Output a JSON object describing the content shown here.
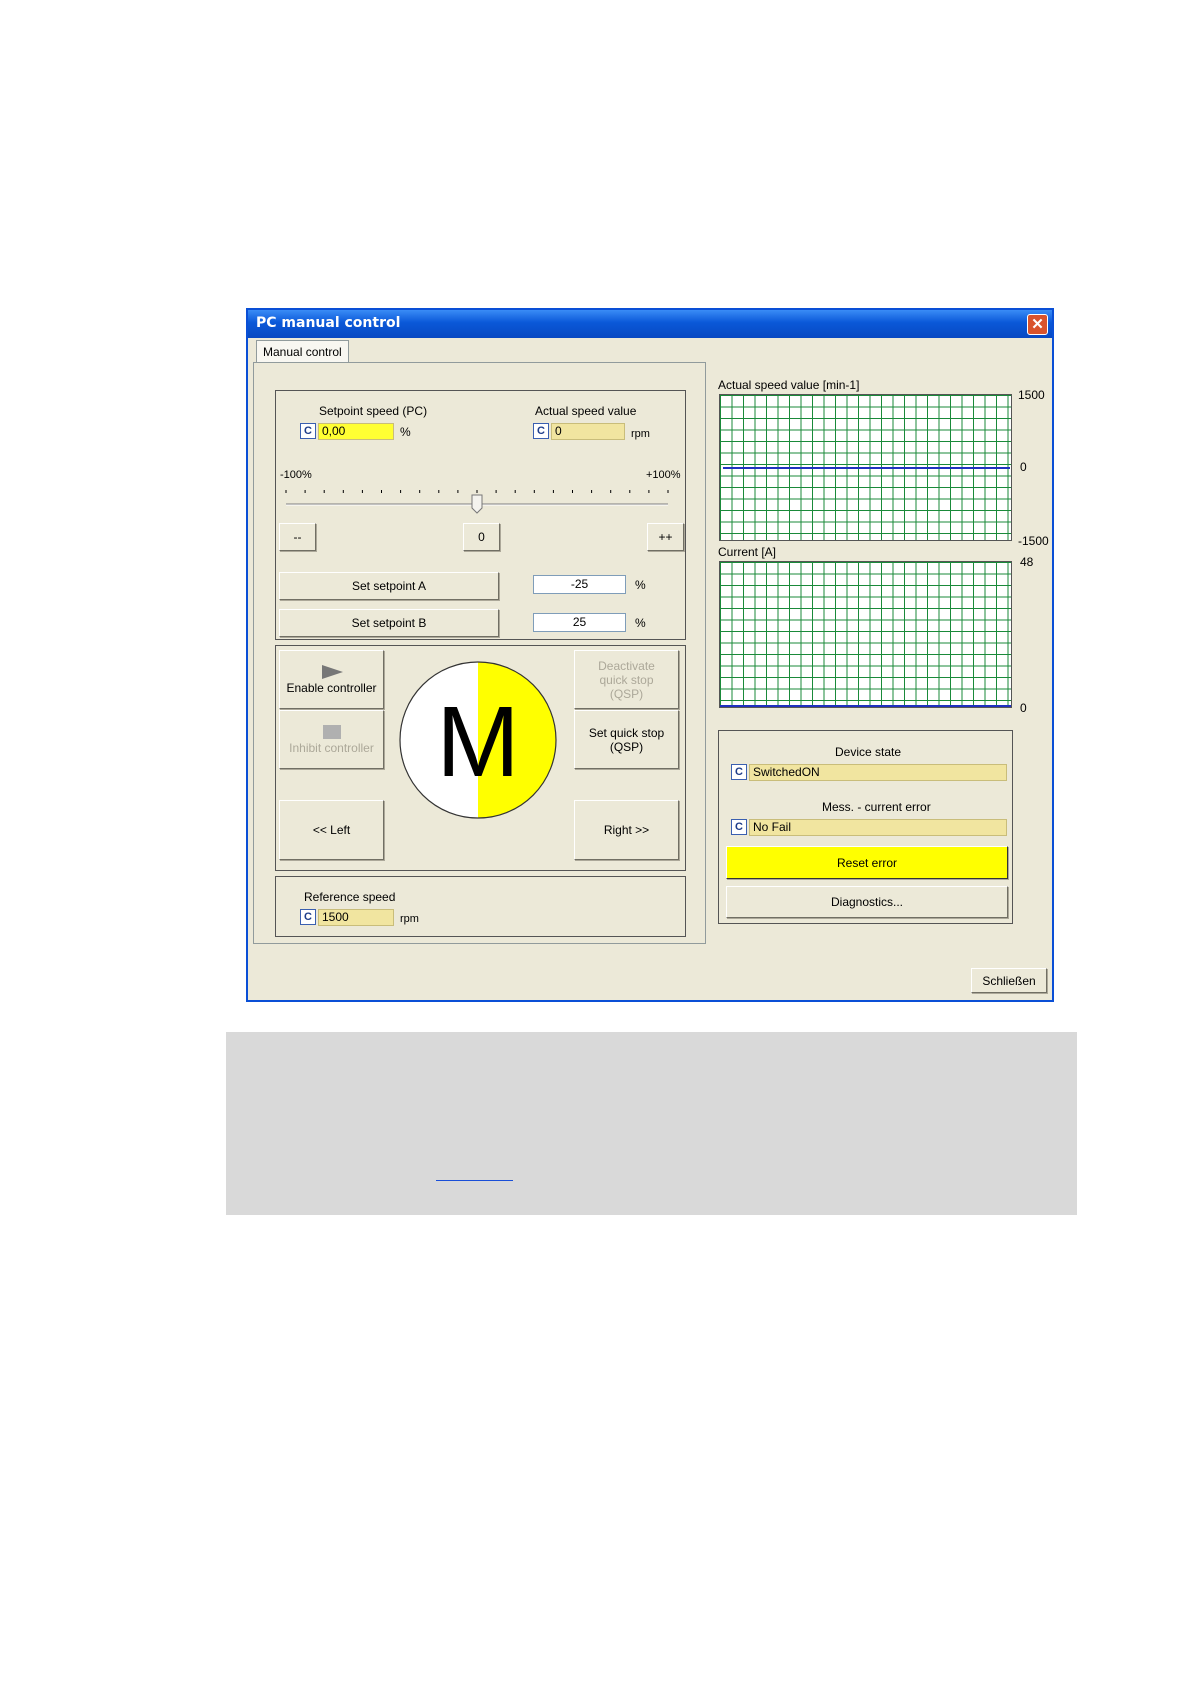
{
  "window": {
    "title": "PC manual control",
    "close_label": "✕"
  },
  "tab": {
    "label": "Manual control"
  },
  "setpoint": {
    "label": "Setpoint speed (PC)",
    "c": "C",
    "value": "0,00",
    "unit": "%",
    "actual_label": "Actual speed value",
    "actual_value": "0",
    "actual_unit": "rpm",
    "slider_min": "-100%",
    "slider_max": "+100%",
    "slider_value": 0,
    "minus_btn": "--",
    "zero_btn": "0",
    "plus_btn": "++",
    "set_a": "Set setpoint A",
    "a_value": "-25",
    "a_unit": "%",
    "set_b": "Set setpoint B",
    "b_value": "25",
    "b_unit": "%"
  },
  "control": {
    "enable": "Enable controller",
    "inhibit": "Inhibit controller",
    "deactivate_qsp": "Deactivate quick stop (QSP)",
    "set_qsp": "Set quick stop (QSP)",
    "left": "<< Left",
    "right": "Right >>",
    "motor_letter": "M",
    "motor_colors": {
      "fill": "#ffff00",
      "blank": "#ffffff"
    }
  },
  "reference": {
    "label": "Reference speed",
    "c": "C",
    "value": "1500",
    "unit": "rpm"
  },
  "speed_chart": {
    "title": "Actual speed value [min-1]",
    "max": "1500",
    "mid": "0",
    "min": "-1500",
    "line_value": 0,
    "line_color": "#2030c0"
  },
  "current_chart": {
    "title": "Current [A]",
    "max": "48",
    "min": "0"
  },
  "status": {
    "device_state_label": "Device state",
    "c": "C",
    "device_state": "SwitchedON",
    "error_label": "Mess. - current error",
    "error_value": "No Fail",
    "reset": "Reset error",
    "diagnostics": "Diagnostics..."
  },
  "footer": {
    "close": "Schließen"
  },
  "note": {
    "link_text": ""
  }
}
